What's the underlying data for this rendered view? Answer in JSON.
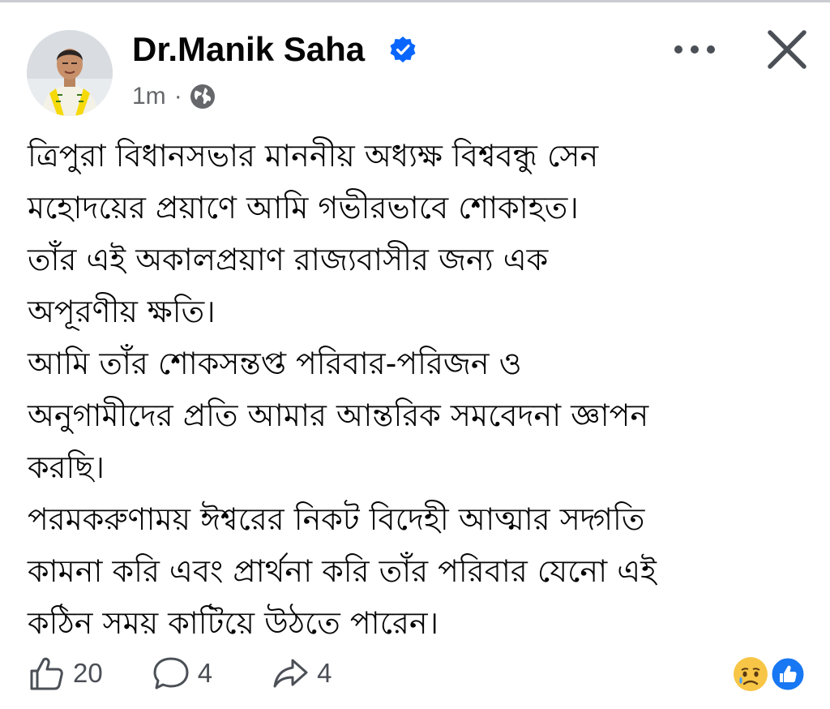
{
  "post": {
    "author": "Dr.Manik Saha",
    "verified": true,
    "time": "1m",
    "separator": "·",
    "audience_icon": "globe-icon",
    "paragraphs": [
      "ত্রিপুরা বিধানসভার মাননীয় অধ্যক্ষ বিশ্ববন্ধু সেন",
      "মহোদয়ের প্রয়াণে আমি গভীরভাবে শোকাহত।",
      "তাঁর এই অকালপ্রয়াণ রাজ্যবাসীর জন্য এক",
      "অপূরণীয় ক্ষতি।",
      "আমি তাঁর শোকসন্তপ্ত পরিবার-পরিজন ও",
      "অনুগামীদের প্রতি আমার আন্তরিক সমবেদনা জ্ঞাপন",
      "করছি।",
      "পরমকরুণাময় ঈশ্বরের নিকট বিদেহী আত্মার সদ্গতি",
      "কামনা করি এবং প্রার্থনা করি তাঁর পরিবার যেনো এই",
      "কঠিন সময়  কাটিয়ে উঠতে পারেন।"
    ]
  },
  "actions": {
    "likes": "20",
    "comments": "4",
    "shares": "4"
  },
  "reactions": [
    "sad-emoji-icon",
    "like-reaction-icon"
  ],
  "colors": {
    "verified_blue": "#0866ff",
    "secondary_text": "#65676b",
    "icon_gray": "#4b4f56",
    "sad_yellow": "#f7c646",
    "tear_blue": "#4fa3f7",
    "reaction_blue": "#1877f2"
  }
}
